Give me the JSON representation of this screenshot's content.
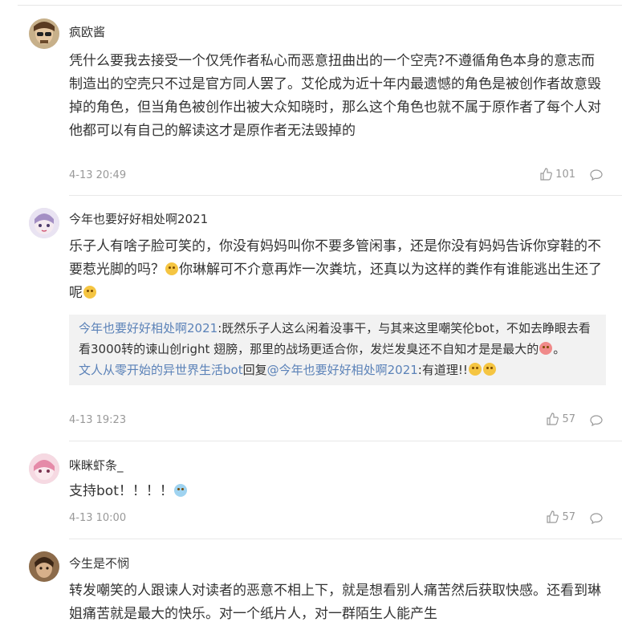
{
  "comments": [
    {
      "username": "疯欧酱",
      "content": "凭什么要我去接受一个仅凭作者私心而恶意扭曲出的一个空壳?不遵循角色本身的意志而制造出的空壳只不过是官方同人罢了。艾伦成为近十年内最遗憾的角色是被创作者故意毁掉的角色，但当角色被创作出被大众知晓时，那么这个角色也就不属于原作者了每个人对他都可以有自己的解读这才是原作者无法毁掉的",
      "time": "4-13 20:49",
      "likes": "101"
    },
    {
      "username": "今年也要好好相处啊2021",
      "content_a": "乐子人有啥子脸可笑的，你没有妈妈叫你不要多管闲事，还是你没有妈妈告诉你穿鞋的不要惹光脚的吗？",
      "content_b": "你琳解可不介意再炸一次粪坑，还真以为这样的粪作有谁能逃出生还了呢",
      "quote_line1_name": "今年也要好好相处啊2021",
      "quote_line1_text": ":既然乐子人这么闲着没事干，与其来这里嘲笑伦bot，不如去睁眼去看看3000转的谏山创right 翅膀，那里的战场更适合你，发烂发臭还不自知才是是最大的",
      "quote_line2_name": "文人从零开始的异世界生活bot",
      "quote_line2_mid": "回复",
      "quote_line2_at": "@今年也要好好相处啊2021",
      "quote_line2_text": ":有道理!!",
      "time": "4-13 19:23",
      "likes": "57"
    },
    {
      "username": "咪眯虾条_",
      "content": "支持bot！！！！",
      "time": "4-13 10:00",
      "likes": "57"
    },
    {
      "username": "今生是不悯",
      "content": "转发嘲笑的人跟谏人对读者的恶意不相上下，就是想看别人痛苦然后获取快感。还看到琳姐痛苦就是最大的快乐。对一个纸片人，对一群陌生人能产生"
    }
  ],
  "colors": {
    "link": "#5b82b8",
    "meta": "#999999",
    "quote_bg": "#f2f2f2"
  }
}
